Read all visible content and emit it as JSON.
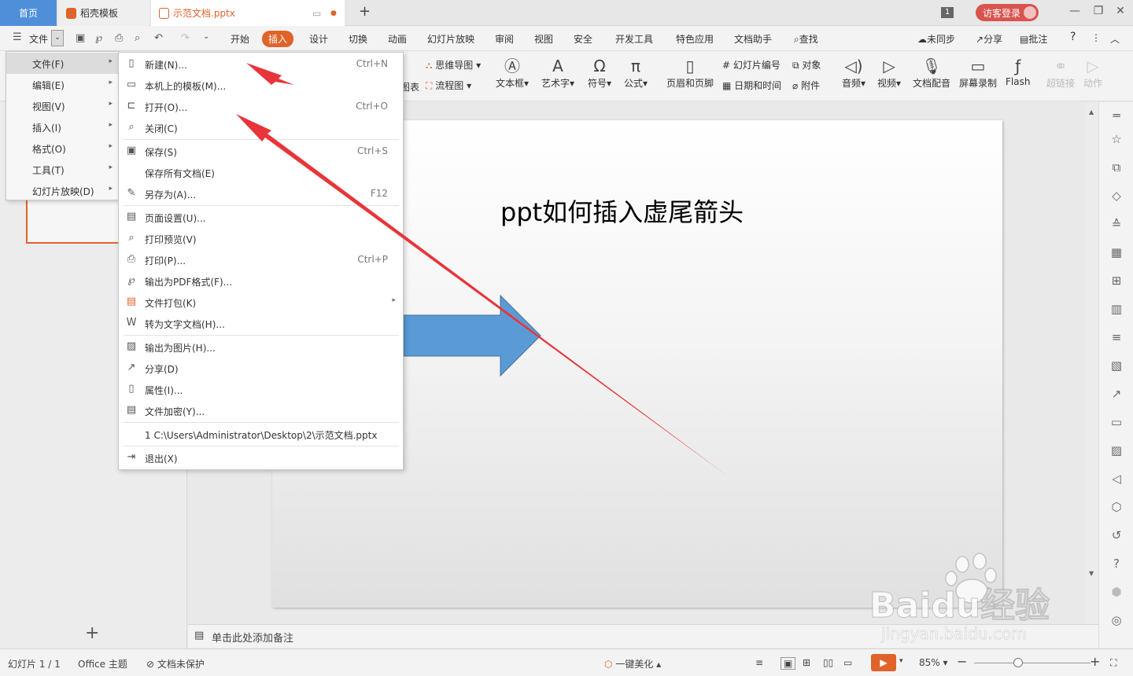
{
  "window": {
    "tab_home": "首页",
    "tab_template": "稻壳模板",
    "tab_document": "示范文档.pptx",
    "badge": "1",
    "login": "访客登录"
  },
  "menubar": {
    "file": "文件",
    "items": [
      "开始",
      "插入",
      "设计",
      "切换",
      "动画",
      "幻灯片放映",
      "审阅",
      "视图",
      "安全",
      "开发工具",
      "特色应用",
      "文档助手"
    ],
    "search": "查找",
    "sync": "未同步",
    "share": "分享",
    "comment": "批注",
    "help": "?"
  },
  "ribbon": {
    "mindmap": "思维导图",
    "flowchart": "流程图",
    "chart_partial": "图表",
    "textbox": "文本框",
    "wordart": "艺术字",
    "symbol": "符号",
    "formula": "公式",
    "header_footer": "页眉和页脚",
    "slide_number": "幻灯片编号",
    "datetime": "日期和时间",
    "object": "对象",
    "attachment": "附件",
    "audio": "音频",
    "video": "视频",
    "voiceover": "文档配音",
    "screen_record": "屏幕录制",
    "flash": "Flash",
    "hyperlink": "超链接",
    "action": "动作"
  },
  "file_menu": {
    "items": [
      {
        "label": "文件(F)"
      },
      {
        "label": "编辑(E)"
      },
      {
        "label": "视图(V)"
      },
      {
        "label": "插入(I)"
      },
      {
        "label": "格式(O)"
      },
      {
        "label": "工具(T)"
      },
      {
        "label": "幻灯片放映(D)"
      }
    ]
  },
  "file_submenu": {
    "items": [
      {
        "label": "新建(N)...",
        "shortcut": "Ctrl+N"
      },
      {
        "label": "本机上的模板(M)...",
        "shortcut": ""
      },
      {
        "label": "打开(O)...",
        "shortcut": "Ctrl+O"
      },
      {
        "label": "关闭(C)",
        "shortcut": ""
      },
      {
        "label": "保存(S)",
        "shortcut": "Ctrl+S"
      },
      {
        "label": "保存所有文档(E)",
        "shortcut": ""
      },
      {
        "label": "另存为(A)...",
        "shortcut": "F12"
      },
      {
        "label": "页面设置(U)...",
        "shortcut": ""
      },
      {
        "label": "打印预览(V)",
        "shortcut": ""
      },
      {
        "label": "打印(P)...",
        "shortcut": "Ctrl+P"
      },
      {
        "label": "输出为PDF格式(F)...",
        "shortcut": ""
      },
      {
        "label": "文件打包(K)",
        "shortcut": ""
      },
      {
        "label": "转为文字文档(H)...",
        "shortcut": ""
      },
      {
        "label": "输出为图片(H)...",
        "shortcut": ""
      },
      {
        "label": "分享(D)",
        "shortcut": ""
      },
      {
        "label": "属性(I)...",
        "shortcut": ""
      },
      {
        "label": "文件加密(Y)...",
        "shortcut": ""
      },
      {
        "label": "1 C:\\Users\\Administrator\\Desktop\\2\\示范文档.pptx",
        "shortcut": ""
      },
      {
        "label": "退出(X)",
        "shortcut": ""
      }
    ]
  },
  "slide": {
    "title": "ppt如何插入虚尾箭头"
  },
  "notes": {
    "placeholder": "单击此处添加备注"
  },
  "status": {
    "slide_count": "幻灯片 1 / 1",
    "theme": "Office 主题",
    "protect": "文档未保护",
    "beautify": "一键美化",
    "zoom": "85%"
  },
  "watermark": {
    "brand": "Baidu经验",
    "url": "jingyan.baidu.com"
  },
  "colors": {
    "accent": "#e0632a",
    "home_tab": "#4f8fd9",
    "arrow_fill": "#5b9bd5",
    "annotation": "#e8353a"
  }
}
